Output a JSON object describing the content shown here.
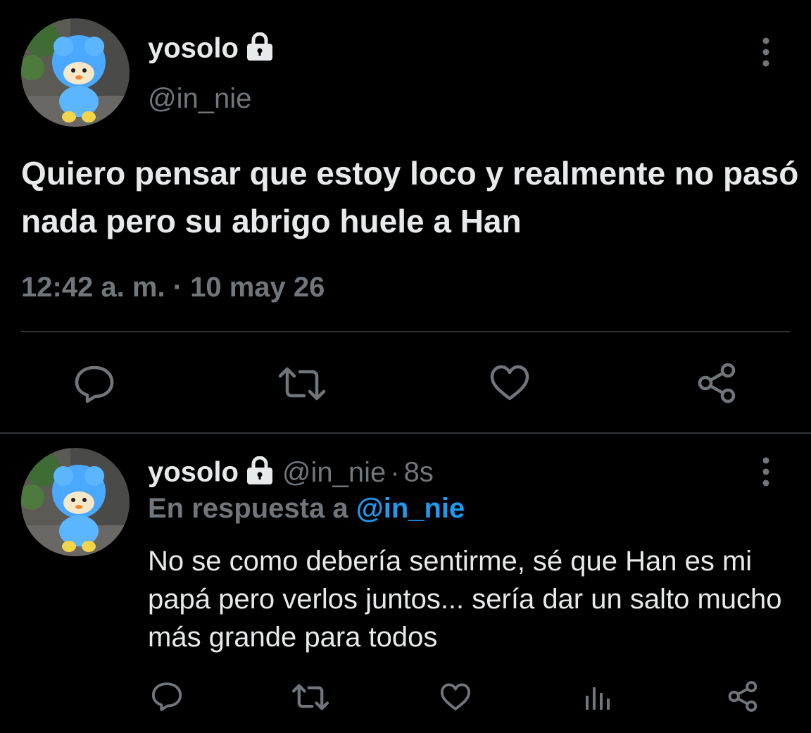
{
  "main_tweet": {
    "display_name": "yosolo",
    "handle": "@in_nie",
    "text": "Quiero pensar que estoy loco y realmente no pasó nada pero su abrigo huele a Han",
    "timestamp": "12:42 a. m. · 10 may 26",
    "icons": [
      "lock-icon",
      "more-vertical-icon",
      "reply-icon",
      "retweet-icon",
      "like-icon",
      "share-icon"
    ]
  },
  "reply_tweet": {
    "display_name": "yosolo",
    "handle": "@in_nie",
    "separator": "·",
    "time_ago": "8s",
    "replying_prefix": "En respuesta a",
    "replying_mention": "@in_nie",
    "text": "No se como debería sentirme, sé que Han es mi papá pero verlos juntos... sería dar un salto mucho más grande para todos",
    "icons": [
      "lock-icon",
      "more-vertical-icon",
      "reply-icon",
      "retweet-icon",
      "like-icon",
      "analytics-icon",
      "share-icon"
    ]
  },
  "colors": {
    "background": "#000000",
    "text_primary": "#e7e9ea",
    "text_secondary": "#71767b",
    "accent": "#1d9bf0",
    "divider": "#2f3336"
  }
}
